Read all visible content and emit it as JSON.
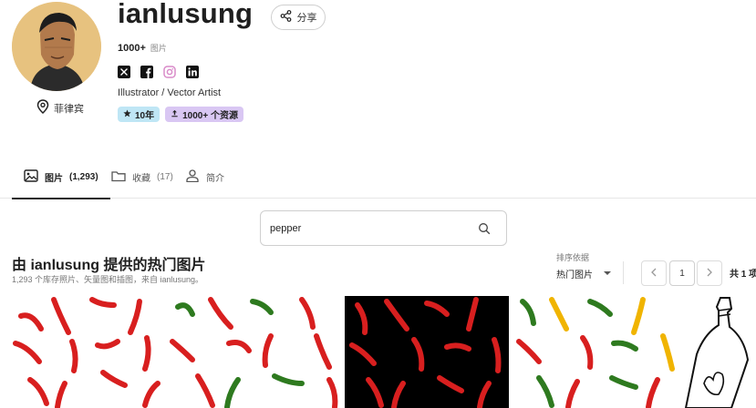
{
  "profile": {
    "username": "ianlusung",
    "share_label": "分享",
    "stats_count": "1000+",
    "stats_unit": "图片",
    "bio": "Illustrator / Vector Artist",
    "location": "菲律宾",
    "badges": {
      "years": "10年",
      "assets": "1000+ 个资源"
    },
    "socials": [
      "x-icon",
      "facebook-icon",
      "instagram-icon",
      "linkedin-icon"
    ]
  },
  "tabs": [
    {
      "label": "图片",
      "count": "(1,293)",
      "active": true,
      "icon": "image-icon"
    },
    {
      "label": "收藏",
      "count": "(17)",
      "active": false,
      "icon": "folder-icon"
    },
    {
      "label": "简介",
      "count": "",
      "active": false,
      "icon": "person-icon"
    }
  ],
  "search": {
    "value": "pepper",
    "icon": "search-icon"
  },
  "section": {
    "title": "由 ianlusung 提供的热门图片",
    "subtitle": "1,293 个库存照片、矢量图和插图，来自 ianlusung。"
  },
  "sort": {
    "label": "排序依据",
    "selected": "热门图片"
  },
  "pagination": {
    "current_page": "1",
    "total": "共 1 项"
  },
  "colors": {
    "accent_dark": "#222222",
    "badge_years": "#bfe6f5",
    "badge_assets": "#d9c7f3",
    "chili_red": "#d81f1f",
    "chili_green": "#2e7a1f",
    "chili_yellow": "#f0b400"
  }
}
